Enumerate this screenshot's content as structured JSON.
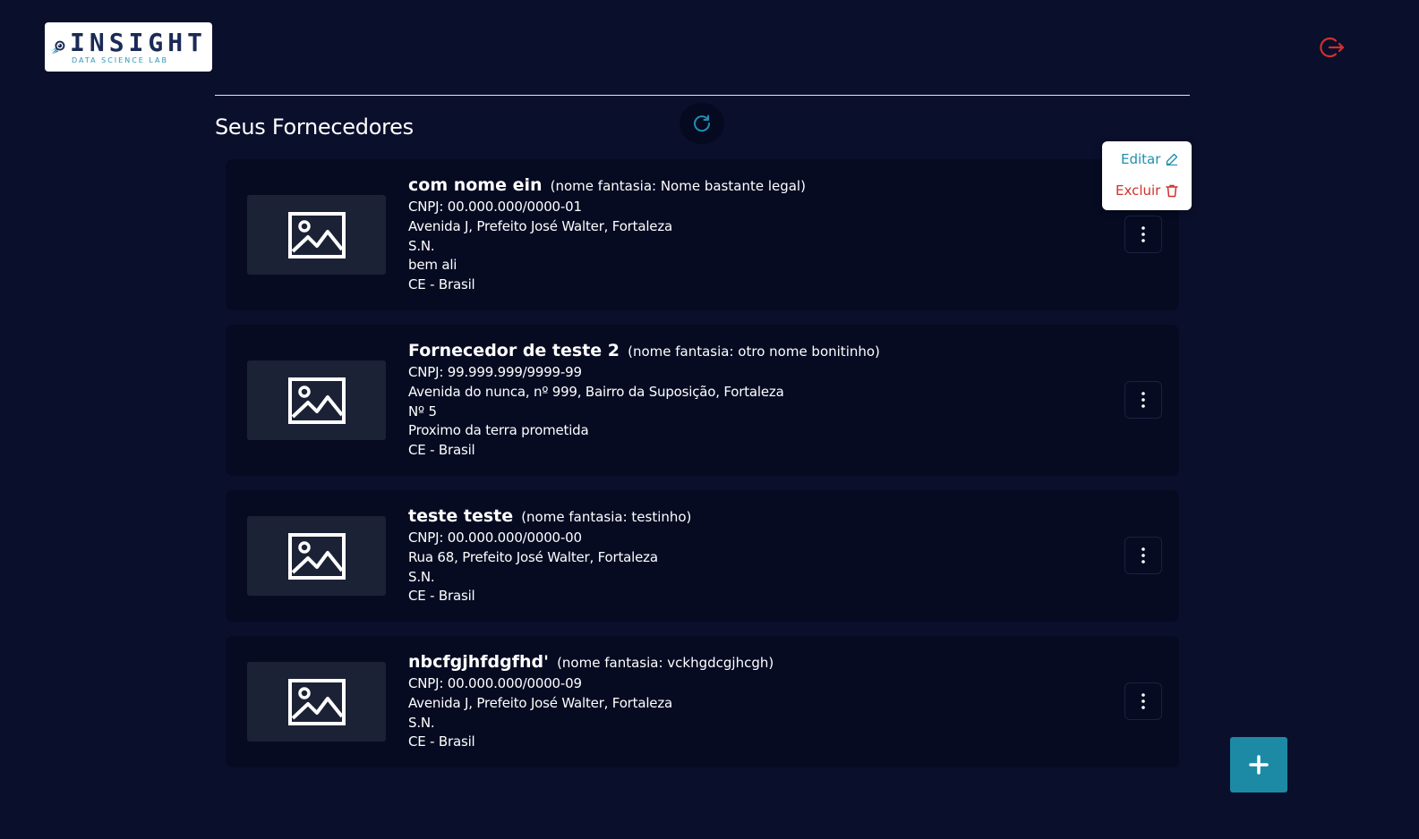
{
  "header": {
    "logo_word": "INSIGHT",
    "logo_sub": "DATA SCIENCE LAB",
    "logout_icon": "logout-icon"
  },
  "main": {
    "title": "Seus Fornecedores",
    "refresh_icon": "refresh-icon"
  },
  "suppliers": [
    {
      "name": "com nome ein",
      "fantasy": "(nome fantasia: Nome bastante legal)",
      "lines": [
        "CNPJ: 00.000.000/0000-01",
        "Avenida J, Prefeito José Walter, Fortaleza",
        "S.N.",
        "bem ali",
        "CE - Brasil"
      ]
    },
    {
      "name": "Fornecedor de teste 2",
      "fantasy": "(nome fantasia: otro nome bonitinho)",
      "lines": [
        "CNPJ: 99.999.999/9999-99",
        "Avenida do nunca, nº 999, Bairro da Suposição, Fortaleza",
        "Nº 5",
        "Proximo da terra prometida",
        "CE - Brasil"
      ]
    },
    {
      "name": "teste teste",
      "fantasy": "(nome fantasia: testinho)",
      "lines": [
        "CNPJ: 00.000.000/0000-00",
        "Rua 68, Prefeito José Walter, Fortaleza",
        "S.N.",
        "CE - Brasil"
      ]
    },
    {
      "name": "nbcfgjhfdgfhd'",
      "fantasy": "(nome fantasia: vckhgdcgjhcgh)",
      "lines": [
        "CNPJ: 00.000.000/0000-09",
        "Avenida J, Prefeito José Walter, Fortaleza",
        "S.N.",
        "CE - Brasil"
      ]
    }
  ],
  "dropdown": {
    "edit_label": "Editar",
    "delete_label": "Excluir"
  },
  "colors": {
    "background": "#0a0f2c",
    "card": "#060b22",
    "accent": "#1d8aa5",
    "danger": "#d0312d"
  }
}
